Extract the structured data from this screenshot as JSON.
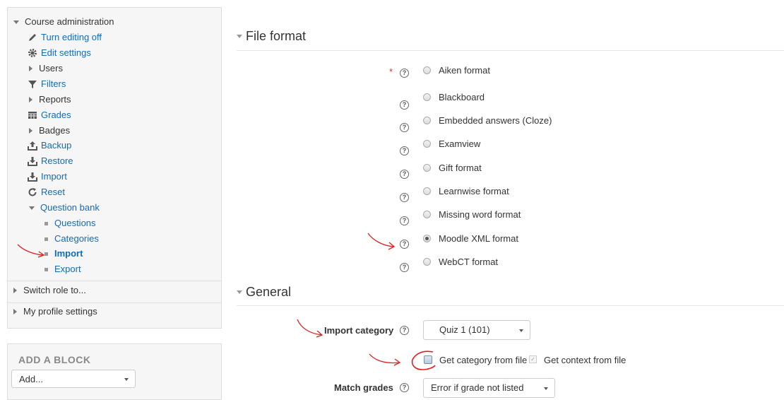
{
  "nav": {
    "course_admin": "Course administration",
    "turn_editing_off": "Turn editing off",
    "edit_settings": "Edit settings",
    "users": "Users",
    "filters": "Filters",
    "reports": "Reports",
    "grades": "Grades",
    "badges": "Badges",
    "backup": "Backup",
    "restore": "Restore",
    "import": "Import",
    "reset": "Reset",
    "question_bank": "Question bank",
    "questions": "Questions",
    "categories": "Categories",
    "qb_import": "Import",
    "export": "Export",
    "switch_role": "Switch role to...",
    "profile_settings": "My profile settings"
  },
  "add_block": {
    "title": "ADD A BLOCK",
    "selected": "Add..."
  },
  "file_format": {
    "title": "File format",
    "required_mark": "*",
    "options": [
      {
        "label": "Aiken format",
        "checked": false
      },
      {
        "label": "Blackboard",
        "checked": false
      },
      {
        "label": "Embedded answers (Cloze)",
        "checked": false
      },
      {
        "label": "Examview",
        "checked": false
      },
      {
        "label": "Gift format",
        "checked": false
      },
      {
        "label": "Learnwise format",
        "checked": false
      },
      {
        "label": "Missing word format",
        "checked": false
      },
      {
        "label": "Moodle XML format",
        "checked": true
      },
      {
        "label": "WebCT format",
        "checked": false
      }
    ]
  },
  "general": {
    "title": "General",
    "import_category_label": "Import category",
    "import_category_value": "Quiz 1 (101)",
    "get_category_label": "Get category from file",
    "get_context_label": "Get context from file",
    "match_grades_label": "Match grades",
    "match_grades_value": "Error if grade not listed"
  },
  "icons": {
    "help": "question-circle-icon",
    "annotation_color": "#e02020",
    "link_color": "#0f6cbf"
  }
}
